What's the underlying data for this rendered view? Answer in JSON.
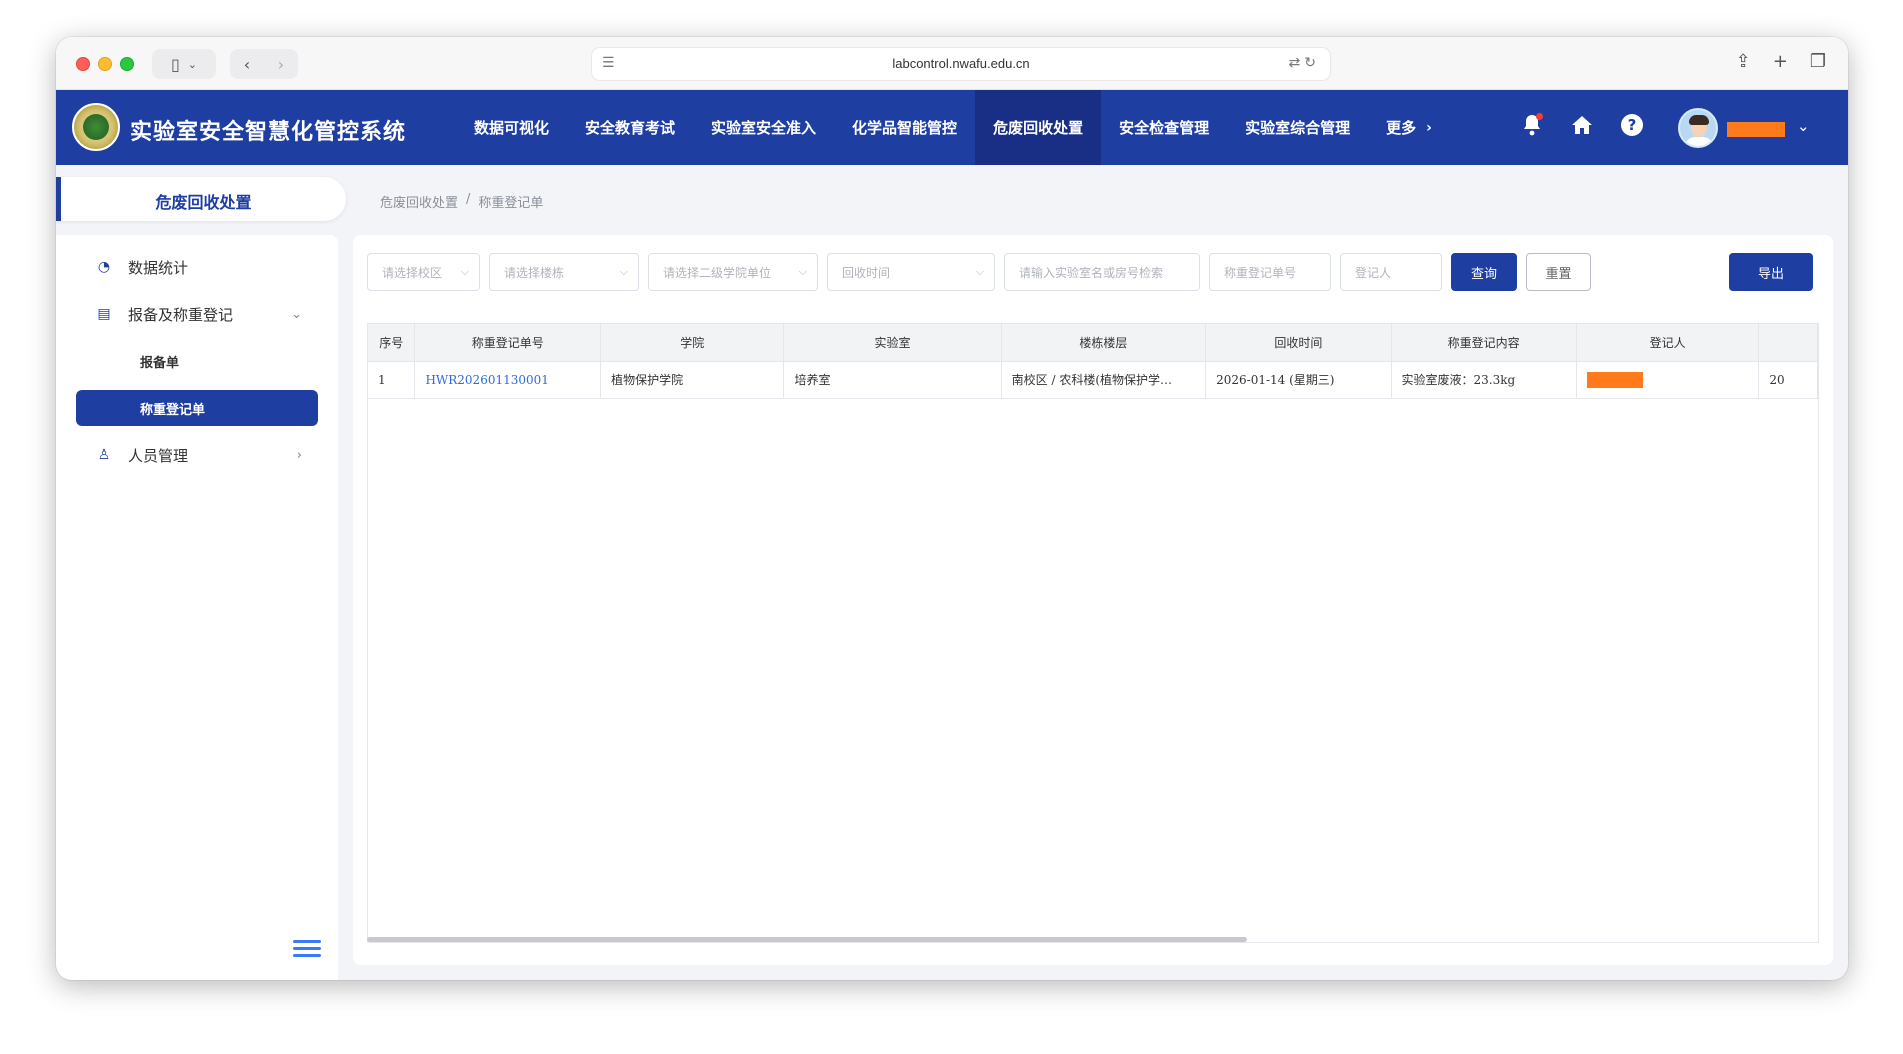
{
  "browser": {
    "url": "labcontrol.nwafu.edu.cn"
  },
  "app": {
    "title": "实验室安全智慧化管控系统",
    "accent_color": "#1e3ea1",
    "redact_color": "#ff7a1a"
  },
  "topnav": [
    {
      "label": "数据可视化",
      "active": false
    },
    {
      "label": "安全教育考试",
      "active": false
    },
    {
      "label": "实验室安全准入",
      "active": false
    },
    {
      "label": "化学品智能管控",
      "active": false
    },
    {
      "label": "危废回收处置",
      "active": true
    },
    {
      "label": "安全检查管理",
      "active": false
    },
    {
      "label": "实验室综合管理",
      "active": false
    },
    {
      "label": "更多",
      "active": false
    }
  ],
  "header_icons": [
    "bell-icon",
    "home-icon",
    "help-icon"
  ],
  "sidebar": {
    "title": "危废回收处置",
    "items": [
      {
        "label": "数据统计",
        "icon": "pie-chart-icon"
      },
      {
        "label": "报备及称重登记",
        "icon": "document-icon",
        "expanded": true,
        "children": [
          {
            "label": "报备单",
            "active": false
          },
          {
            "label": "称重登记单",
            "active": true
          }
        ]
      },
      {
        "label": "人员管理",
        "icon": "user-icon",
        "expanded": false
      }
    ]
  },
  "breadcrumb": [
    "危废回收处置",
    "/",
    "称重登记单"
  ],
  "filters": {
    "campus_placeholder": "请选择校区",
    "building_placeholder": "请选择楼栋",
    "college_placeholder": "请选择二级学院单位",
    "time_placeholder": "回收时间",
    "lab_search_placeholder": "请输入实验室名或房号检索",
    "record_no_placeholder": "称重登记单号",
    "registrant_placeholder": "登记人",
    "query_label": "查询",
    "reset_label": "重置",
    "export_label": "导出"
  },
  "table": {
    "columns": [
      "序号",
      "称重登记单号",
      "学院",
      "实验室",
      "楼栋楼层",
      "回收时间",
      "称重登记内容",
      "登记人",
      ""
    ],
    "rows": [
      {
        "index": "1",
        "record_no": "HWR202601130001",
        "college": "植物保护学院",
        "lab": "培养室",
        "building": "南校区 / 农科楼(植物保护学…",
        "time": "2026-01-14 (星期三)",
        "content": "实验室废液：23.3kg",
        "registrant": "",
        "extra": "20"
      }
    ]
  }
}
